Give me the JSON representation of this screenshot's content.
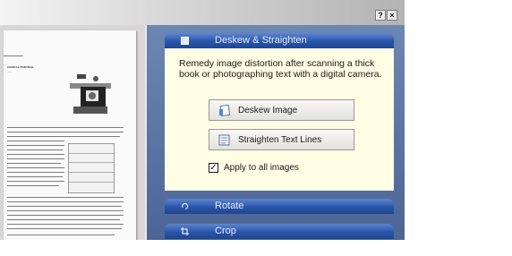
{
  "window": {
    "help_label": "?",
    "close_label": "×"
  },
  "preview": {
    "page_heading": "CONICAL PORTRAIL",
    "page_subheading": "——"
  },
  "pane": {
    "deskew_section": {
      "title": "Deskew & Straighten",
      "icon": "deskew-section-icon",
      "description": "Remedy image distortion after scanning a thick book or photographing text with a digital camera.",
      "deskew_button_label": "Deskew Image",
      "straighten_button_label": "Straighten Text Lines",
      "apply_all_label": "Apply to all images",
      "apply_all_checked": true
    },
    "rotate_section": {
      "title": "Rotate",
      "icon": "rotate-icon"
    },
    "crop_section": {
      "title": "Crop",
      "icon": "crop-icon"
    }
  },
  "colors": {
    "pane_bg": "#5a72a4",
    "header_bg": "#2a55a8",
    "section_body_bg": "#fffde4"
  }
}
